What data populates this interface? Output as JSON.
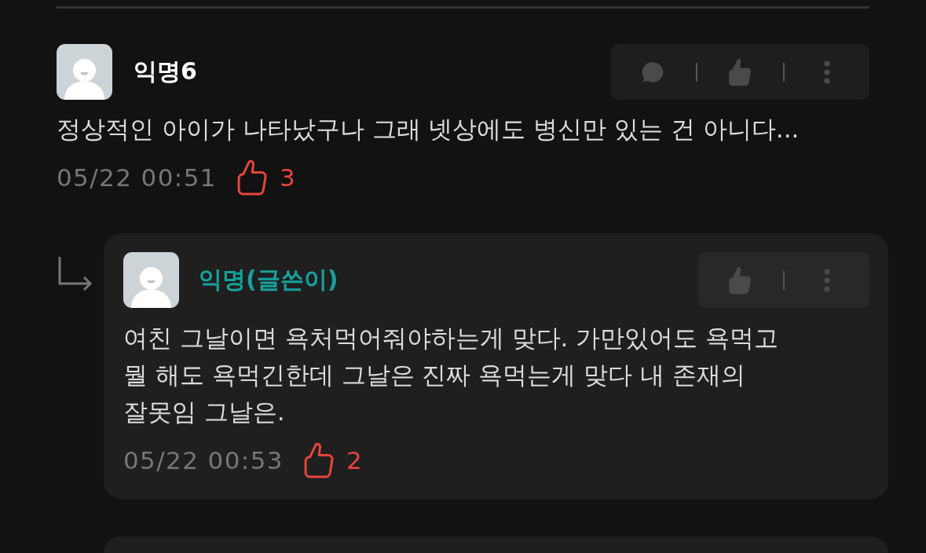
{
  "comments": [
    {
      "author": "익명6",
      "is_op": false,
      "actions": [
        {
          "kind": "reply"
        },
        {
          "kind": "like"
        },
        {
          "kind": "more"
        }
      ],
      "text": "정상적인 아이가 나타났구나 그래 넷상에도 병신만 있는 건 아니다...",
      "time": "05/22 00:51",
      "likes": "3",
      "replies": [
        {
          "kind": "card",
          "author": "익명(글쓴이)",
          "is_op": true,
          "actions": [
            {
              "kind": "like"
            },
            {
              "kind": "more"
            }
          ],
          "text": "여친 그날이면 욕처먹어줘야하는게 맞다. 가만있어도 욕먹고 뭘 해도 욕먹긴한데 그날은 진짜 욕먹는게 맞다 내 존재의 잘못임 그날은.",
          "time": "05/22 00:53",
          "likes": "2"
        },
        {
          "kind": "card_edge"
        }
      ]
    }
  ]
}
